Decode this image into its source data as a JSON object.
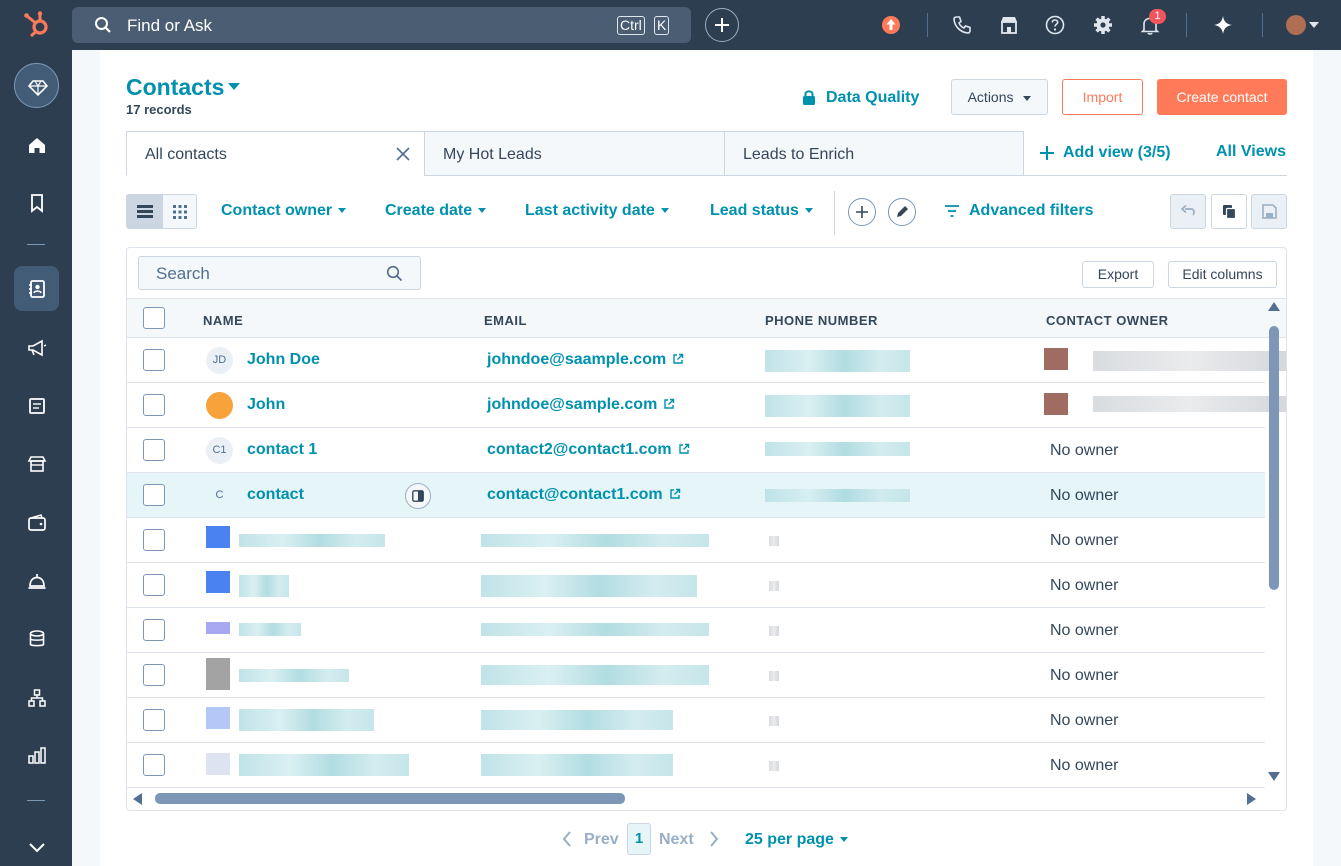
{
  "topbar": {
    "search_placeholder": "Find or Ask",
    "shortcut_keys": [
      "Ctrl",
      "K"
    ],
    "notification_count": "1"
  },
  "header": {
    "title": "Contacts",
    "records": "17 records",
    "data_quality": "Data Quality",
    "actions_label": "Actions",
    "import_label": "Import",
    "create_label": "Create contact"
  },
  "tabs": [
    {
      "label": "All contacts",
      "active": true
    },
    {
      "label": "My Hot Leads",
      "active": false
    },
    {
      "label": "Leads to Enrich",
      "active": false
    }
  ],
  "views": {
    "add_view": "Add view (3/5)",
    "all_views": "All Views"
  },
  "filters": {
    "contact_owner": "Contact owner",
    "create_date": "Create date",
    "last_activity": "Last activity date",
    "lead_status": "Lead status",
    "advanced": "Advanced filters"
  },
  "table": {
    "search_placeholder": "Search",
    "export_label": "Export",
    "edit_columns_label": "Edit columns",
    "columns": [
      "NAME",
      "EMAIL",
      "PHONE NUMBER",
      "CONTACT OWNER"
    ],
    "rows": [
      {
        "initials": "JD",
        "name": "John Doe",
        "email": "johndoe@saample.com",
        "owner": ""
      },
      {
        "initials": "",
        "name": "John",
        "email": "johndoe@sample.com",
        "owner": ""
      },
      {
        "initials": "C1",
        "name": "contact 1",
        "email": "contact2@contact1.com",
        "owner": "No owner"
      },
      {
        "initials": "C",
        "name": "contact",
        "email": "contact@contact1.com",
        "owner": "No owner"
      },
      {
        "initials": "",
        "name": "",
        "email": "",
        "owner": "No owner"
      },
      {
        "initials": "",
        "name": "",
        "email": "",
        "owner": "No owner"
      },
      {
        "initials": "",
        "name": "",
        "email": "",
        "owner": "No owner"
      },
      {
        "initials": "",
        "name": "",
        "email": "",
        "owner": "No owner"
      },
      {
        "initials": "",
        "name": "",
        "email": "",
        "owner": "No owner"
      },
      {
        "initials": "",
        "name": "",
        "email": "",
        "owner": "No owner"
      }
    ]
  },
  "pagination": {
    "prev": "Prev",
    "page": "1",
    "next": "Next",
    "per_page": "25 per page"
  },
  "colors": {
    "nav_bg": "#2d3e50",
    "link": "#0091ae",
    "accent": "#ff7a59",
    "highlight_row": "#e5f5f8"
  }
}
